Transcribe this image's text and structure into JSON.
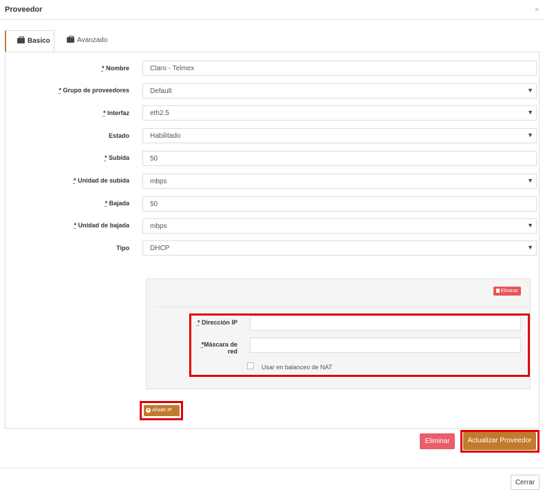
{
  "modal": {
    "title": "Proveedor",
    "close_symbol": "×"
  },
  "tabs": [
    {
      "label": "Basico",
      "icon": "briefcase-icon"
    },
    {
      "label": "Avanzado",
      "icon": "briefcase-icon"
    }
  ],
  "form": {
    "nombre": {
      "label": "Nombre",
      "req": "*",
      "value": "Claro - Telmex"
    },
    "grupo": {
      "label": "Grupo de proveedores",
      "req": "*",
      "value": "Default"
    },
    "interfaz": {
      "label": "Interfaz",
      "req": "*",
      "value": "eth2.5"
    },
    "estado": {
      "label": "Estado",
      "value": "Habilitado"
    },
    "subida": {
      "label": "Subida",
      "req": "*",
      "value": "50"
    },
    "unidad_subida": {
      "label": "Unidad de subida",
      "req": "*",
      "value": "mbps"
    },
    "bajada": {
      "label": "Bajada",
      "req": "*",
      "value": "50"
    },
    "unidad_bajada": {
      "label": "Unidad de bajada",
      "req": "*",
      "value": "mbps"
    },
    "tipo": {
      "label": "Tipo",
      "value": "DHCP"
    },
    "caret": "▼"
  },
  "ip_block": {
    "delete_label": "Eliminar",
    "direccion_label": "Dirección IP",
    "direccion_req": "*",
    "direccion_value": "",
    "mascara_label": "Máscara de red",
    "mascara_req": "*",
    "mascara_value": "",
    "nat_label": "Usar en balanceo de NAT",
    "nat_checked": false
  },
  "add_ip_label": "Añadir IP",
  "actions": {
    "delete_label": "Eliminar",
    "update_label": "Actualizar Proveedor"
  },
  "footer": {
    "close_label": "Cerrar"
  },
  "colors": {
    "accent": "#c27a2e",
    "danger": "#e85e6c",
    "highlight": "#e00000"
  }
}
